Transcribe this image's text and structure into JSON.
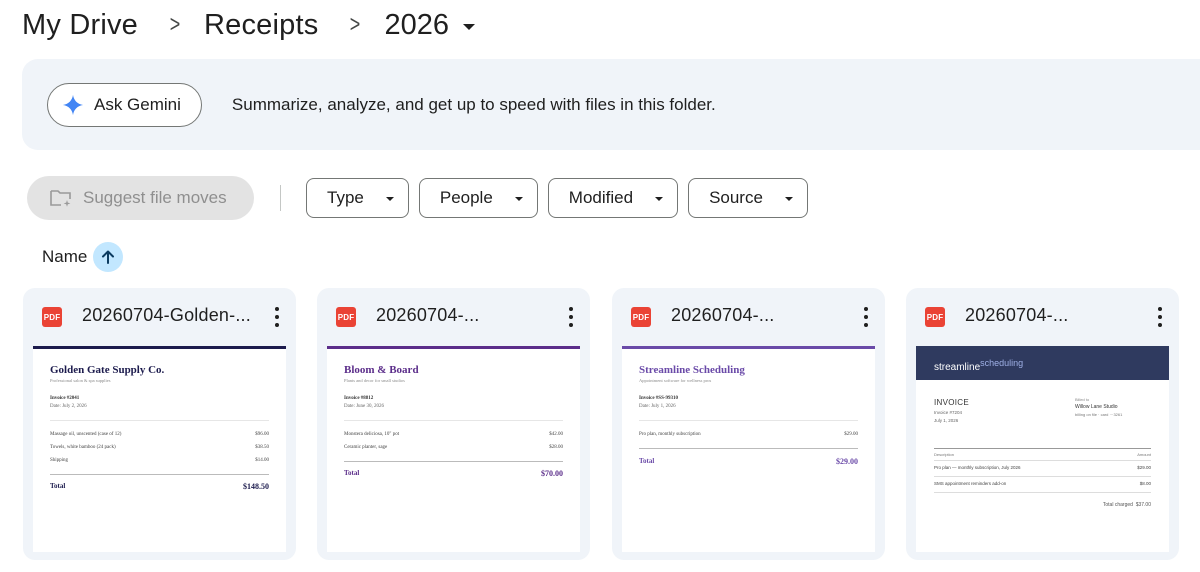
{
  "breadcrumb": {
    "items": [
      "My Drive",
      "Receipts",
      "2026"
    ],
    "separator": ">"
  },
  "gemini": {
    "button_label": "Ask Gemini",
    "banner_text": "Summarize, analyze, and get up to speed with files in this folder."
  },
  "filters": {
    "suggest_label": "Suggest file moves",
    "chips": [
      "Type",
      "People",
      "Modified",
      "Source"
    ]
  },
  "sort": {
    "label": "Name",
    "direction": "ascending"
  },
  "files": [
    {
      "name": "20260704-Golden-...",
      "type_badge": "PDF",
      "preview": {
        "company": "Golden Gate Supply Co.",
        "tagline": "Professional salon & spa supplies",
        "invoice": "Invoice #2041",
        "date": "Date: July 2, 2026",
        "lines": [
          {
            "desc": "Massage oil, unscented (case of 12)",
            "amount": "$96.00"
          },
          {
            "desc": "Towels, white bamboo (24 pack)",
            "amount": "$38.50"
          },
          {
            "desc": "Shipping",
            "amount": "$14.00"
          }
        ],
        "total_label": "Total",
        "total": "$148.50",
        "accent": "#1c1b4d"
      }
    },
    {
      "name": "20260704-...",
      "type_badge": "PDF",
      "preview": {
        "company": "Bloom & Board",
        "tagline": "Plants and decor for small studios",
        "invoice": "Invoice #8812",
        "date": "Date: June 30, 2026",
        "lines": [
          {
            "desc": "Monstera deliciosa, 10\" pot",
            "amount": "$42.00"
          },
          {
            "desc": "Ceramic planter, sage",
            "amount": "$28.00"
          }
        ],
        "total_label": "Total",
        "total": "$70.00",
        "accent": "#5b2d8a"
      }
    },
    {
      "name": "20260704-...",
      "type_badge": "PDF",
      "preview": {
        "company": "Streamline Scheduling",
        "tagline": "Appointment software for wellness pros",
        "invoice": "Invoice #SS-99310",
        "date": "Date: July 1, 2026",
        "lines": [
          {
            "desc": "Pro plan, monthly subscription",
            "amount": "$29.00"
          }
        ],
        "total_label": "Total",
        "total": "$29.00",
        "accent": "#6a4aa8"
      }
    },
    {
      "name": "20260704-...",
      "type_badge": "PDF",
      "preview": {
        "logo_main": "streamline",
        "logo_sup": "scheduling",
        "heading": "INVOICE",
        "invoice_no": "Invoice #7204",
        "date": "July 1, 2026",
        "billed_to_label": "Billed to",
        "billed_to": "Willow Lane Studio",
        "billing_note": "billing on file · card ···3261",
        "col_desc": "Description",
        "col_amount": "Amount",
        "lines": [
          {
            "desc": "Pro plan — monthly subscription, July 2026",
            "amount": "$29.00"
          },
          {
            "desc": "SMS appointment reminders add-on",
            "amount": "$8.00"
          }
        ],
        "total_label": "Total charged",
        "total": "$37.00",
        "header_color": "#2f3a5f"
      }
    }
  ],
  "colors": {
    "banner_bg": "#f0f4f9",
    "card_bg": "#f0f4f9",
    "sort_badge": "#c2e7ff",
    "pdf_red": "#ea4335",
    "gemini_blue": "#4285f4"
  }
}
